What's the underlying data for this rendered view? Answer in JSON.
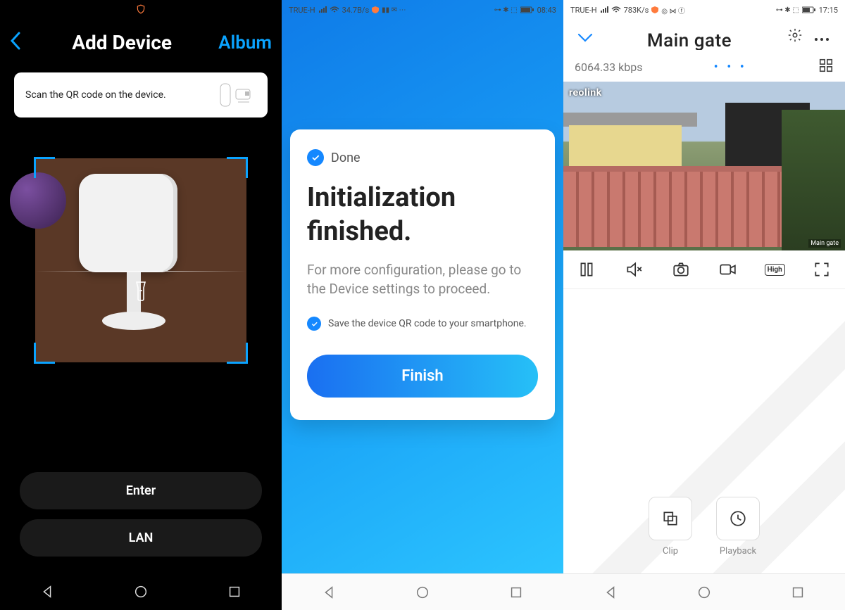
{
  "screen1": {
    "statusbar": {
      "shield_icon": "shield"
    },
    "header": {
      "title": "Add Device",
      "album": "Album",
      "back_icon": "chevron-left"
    },
    "instruction": "Scan the QR code on the device.",
    "buttons": {
      "enter": "Enter",
      "lan": "LAN"
    }
  },
  "screen2": {
    "statusbar": {
      "carrier": "TRUE-H",
      "network_speed": "34.7B/s",
      "time": "08:43"
    },
    "card": {
      "done_label": "Done",
      "title": "Initialization finished.",
      "subtext": "For more configuration, please go to the Device settings to proceed.",
      "save_qr_label": "Save the device QR code to your smartphone.",
      "finish_button": "Finish"
    }
  },
  "screen3": {
    "statusbar": {
      "carrier": "TRUE-H",
      "network_speed": "783K/s",
      "time": "17:15"
    },
    "header": {
      "camera_name": "Main gate"
    },
    "bitrate": "6064.33 kbps",
    "video": {
      "brand_logo": "reolink",
      "overlay_label": "Main gate"
    },
    "toolbar": {
      "quality": "High"
    },
    "actions": {
      "clip": "Clip",
      "playback": "Playback"
    }
  },
  "colors": {
    "accent_blue": "#1588ff"
  }
}
